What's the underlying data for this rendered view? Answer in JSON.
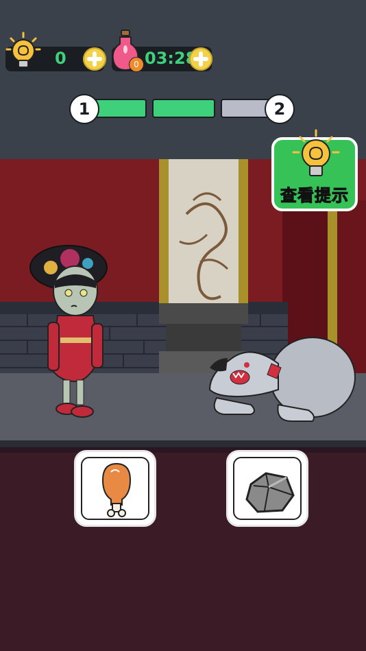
{
  "hud": {
    "hints": {
      "count": "0",
      "icon": "bulb-brain-icon"
    },
    "timer": {
      "potion_badge": "0",
      "time": "03:28",
      "icon": "potion-bottle-icon"
    }
  },
  "progress": {
    "start_label": "1",
    "end_label": "2",
    "segments": [
      "done",
      "done",
      "pending"
    ],
    "colors": {
      "done": "#3fd07c",
      "pending": "#b9bcc8"
    }
  },
  "hint_button": {
    "label": "查看提示",
    "icon": "bulb-brain-icon"
  },
  "scene": {
    "characters": [
      "queen-character",
      "angry-bulldog"
    ]
  },
  "items": [
    {
      "name": "chicken-drumstick",
      "icon": "drumstick-icon"
    },
    {
      "name": "rock",
      "icon": "rock-icon"
    }
  ],
  "colors": {
    "accent_green": "#37c258",
    "plus_yellow": "#f3d24a",
    "wall_red": "#7a1c22"
  }
}
